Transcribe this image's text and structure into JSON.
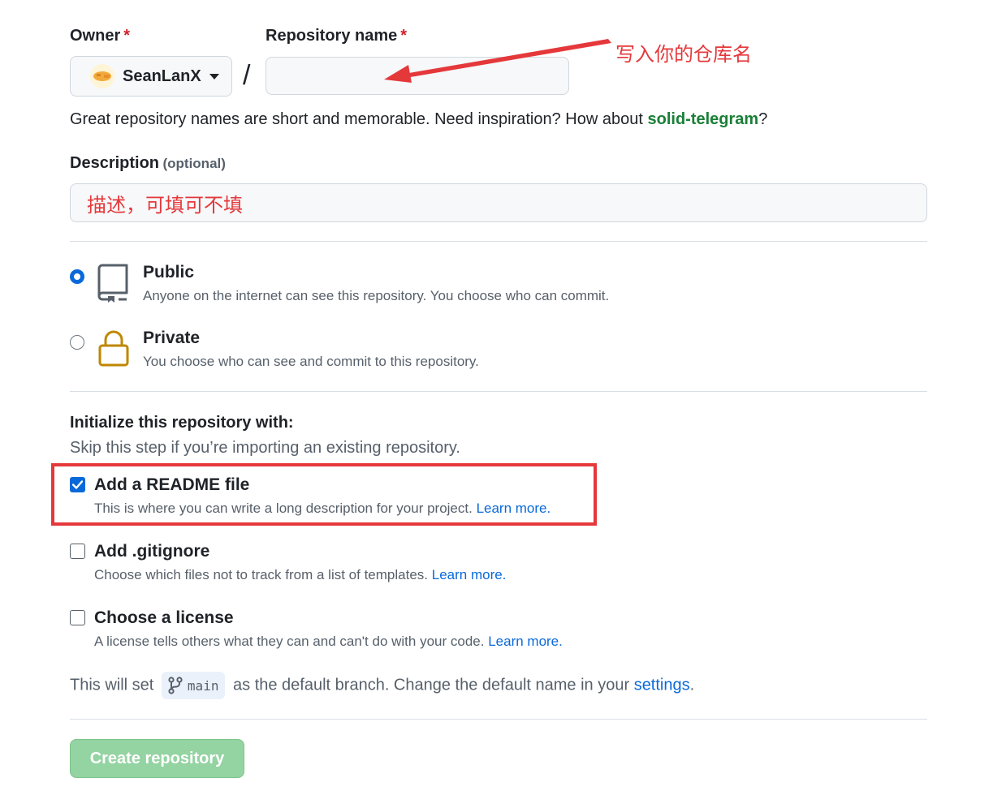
{
  "owner": {
    "label": "Owner",
    "required_mark": "*",
    "name": "SeanLanX"
  },
  "repo_name": {
    "label": "Repository name",
    "required_mark": "*",
    "value": "",
    "annotation": "写入你的仓库名"
  },
  "separator": "/",
  "name_hint": {
    "text": "Great repository names are short and memorable. Need inspiration? How about ",
    "suggestion": "solid-telegram",
    "end": "?"
  },
  "description": {
    "label": "Description",
    "optional": "(optional)",
    "value": "描述，可填可不填"
  },
  "visibility": [
    {
      "title": "Public",
      "desc": "Anyone on the internet can see this repository. You choose who can commit.",
      "checked": true
    },
    {
      "title": "Private",
      "desc": "You choose who can see and commit to this repository.",
      "checked": false
    }
  ],
  "init": {
    "heading": "Initialize this repository with:",
    "subheading": "Skip this step if you’re importing an existing repository.",
    "options": [
      {
        "title": "Add a README file",
        "desc": "This is where you can write a long description for your project.",
        "link": "Learn more.",
        "checked": true
      },
      {
        "title": "Add .gitignore",
        "desc": "Choose which files not to track from a list of templates.",
        "link": "Learn more.",
        "checked": false
      },
      {
        "title": "Choose a license",
        "desc": "A license tells others what they can and can't do with your code.",
        "link": "Learn more.",
        "checked": false
      }
    ]
  },
  "branch": {
    "prefix": "This will set",
    "name": "main",
    "middle": "as the default branch. Change the default name in your",
    "link": "settings",
    "end": "."
  },
  "create_button": "Create repository",
  "colors": {
    "accent": "#0969da",
    "success": "#1a7f37",
    "annotation": "#e5383b",
    "button_disabled": "#94d3a2"
  }
}
